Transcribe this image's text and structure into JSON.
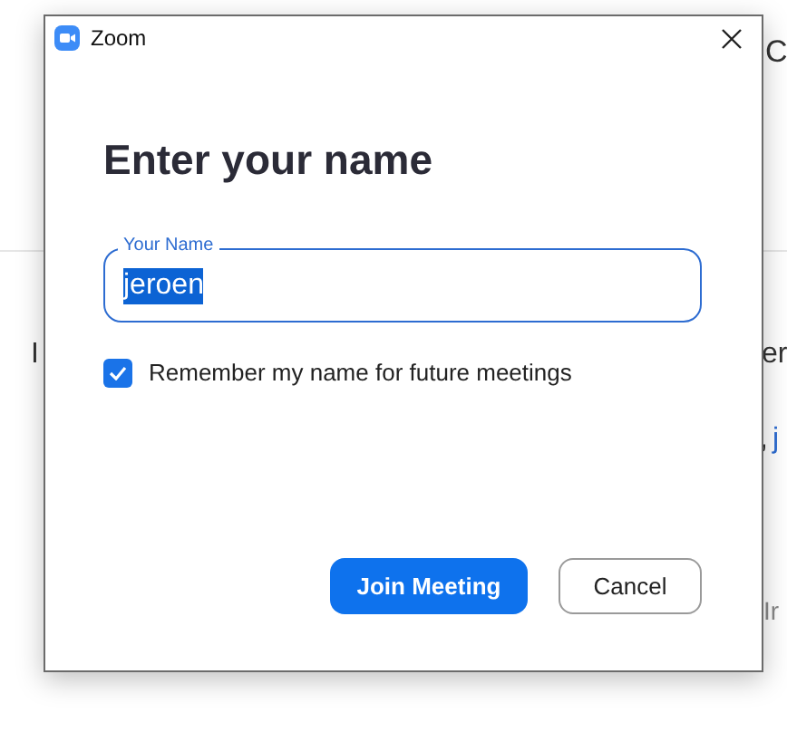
{
  "background": {
    "texts": [
      {
        "text": "C",
        "kind": "plain"
      },
      {
        "text": "I",
        "kind": "plain"
      },
      {
        "text": "er",
        "kind": "plain"
      },
      {
        "text": ",",
        "kind": "plain"
      },
      {
        "text": "j",
        "kind": "link"
      },
      {
        "text": "Ir",
        "kind": "muted"
      }
    ]
  },
  "dialog": {
    "title": "Zoom",
    "heading": "Enter your name",
    "name_field": {
      "label": "Your Name",
      "value": "jeroen",
      "text_selected": true,
      "focused": true
    },
    "remember": {
      "label": "Remember my name for future meetings",
      "checked": true
    },
    "buttons": [
      {
        "label": "Join Meeting",
        "kind": "primary"
      },
      {
        "label": "Cancel",
        "kind": "secondary"
      }
    ]
  }
}
